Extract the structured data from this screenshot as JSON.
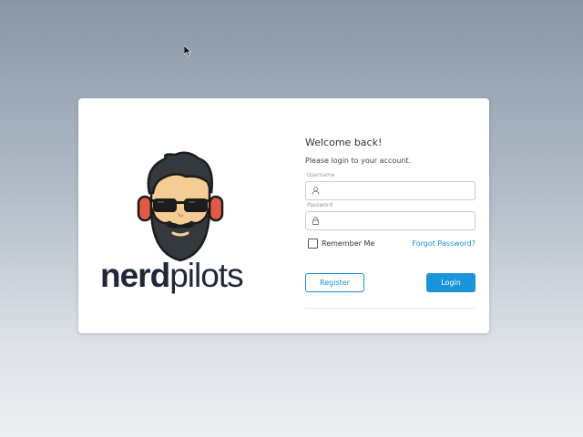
{
  "brand": {
    "name_bold": "nerd",
    "name_light": "pilots",
    "mascot_icon": "bearded-man-headphones-icon"
  },
  "login": {
    "welcome": "Welcome back!",
    "subtitle": "Please login to your account.",
    "username_label": "Username",
    "username_icon": "user-icon",
    "password_label": "Password",
    "password_icon": "lock-icon",
    "remember_label": "Remember Me",
    "forgot_link": "Forgot Password?",
    "register_button": "Register",
    "login_button": "Login"
  },
  "colors": {
    "accent": "#1896dc",
    "brand_text": "#22263a"
  }
}
